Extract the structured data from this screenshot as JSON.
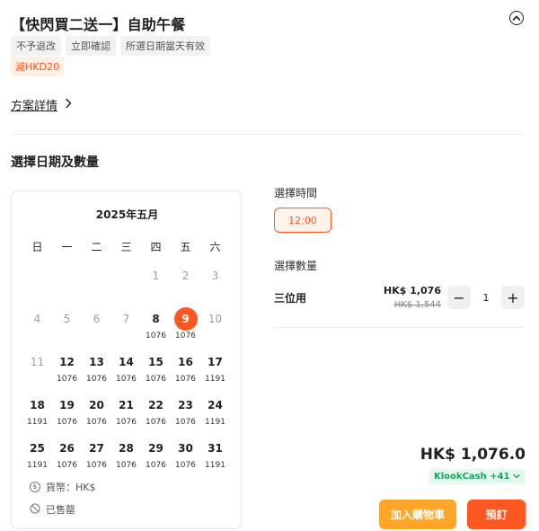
{
  "title": "【快閃買二送一】自助午餐",
  "tags": [
    "不予退改",
    "立即確認",
    "所選日期當天有效"
  ],
  "discount_badge": "減HKD20",
  "plan_details_link": "方案詳情",
  "section_title": "選擇日期及數量",
  "calendar": {
    "month_label": "2025年五月",
    "weekdays": [
      "日",
      "一",
      "二",
      "三",
      "四",
      "五",
      "六"
    ],
    "weeks": [
      [
        null,
        null,
        null,
        null,
        {
          "day": "1",
          "price": "",
          "available": false
        },
        {
          "day": "2",
          "price": "",
          "available": false
        },
        {
          "day": "3",
          "price": "",
          "available": false
        }
      ],
      [
        {
          "day": "4",
          "price": "",
          "available": false
        },
        {
          "day": "5",
          "price": "",
          "available": false
        },
        {
          "day": "6",
          "price": "",
          "available": false
        },
        {
          "day": "7",
          "price": "",
          "available": false
        },
        {
          "day": "8",
          "price": "1076",
          "available": true
        },
        {
          "day": "9",
          "price": "1076",
          "available": true,
          "selected": true
        },
        {
          "day": "10",
          "price": "",
          "available": false
        }
      ],
      [
        {
          "day": "11",
          "price": "",
          "available": false
        },
        {
          "day": "12",
          "price": "1076",
          "available": true
        },
        {
          "day": "13",
          "price": "1076",
          "available": true
        },
        {
          "day": "14",
          "price": "1076",
          "available": true
        },
        {
          "day": "15",
          "price": "1076",
          "available": true
        },
        {
          "day": "16",
          "price": "1076",
          "available": true
        },
        {
          "day": "17",
          "price": "1191",
          "available": true
        }
      ],
      [
        {
          "day": "18",
          "price": "1191",
          "available": true
        },
        {
          "day": "19",
          "price": "1076",
          "available": true
        },
        {
          "day": "20",
          "price": "1076",
          "available": true
        },
        {
          "day": "21",
          "price": "1076",
          "available": true
        },
        {
          "day": "22",
          "price": "1076",
          "available": true
        },
        {
          "day": "23",
          "price": "1076",
          "available": true
        },
        {
          "day": "24",
          "price": "1191",
          "available": true
        }
      ],
      [
        {
          "day": "25",
          "price": "1191",
          "available": true
        },
        {
          "day": "26",
          "price": "1076",
          "available": true
        },
        {
          "day": "27",
          "price": "1076",
          "available": true
        },
        {
          "day": "28",
          "price": "1076",
          "available": true
        },
        {
          "day": "29",
          "price": "1076",
          "available": true
        },
        {
          "day": "30",
          "price": "1076",
          "available": true
        },
        {
          "day": "31",
          "price": "1191",
          "available": true
        }
      ]
    ],
    "currency_note": "貨幣：HK$",
    "sold_out_note": "已售罄"
  },
  "time": {
    "label": "選擇時間",
    "selected": "12:00"
  },
  "quantity": {
    "label": "選擇數量",
    "item_name": "三位用",
    "price": "HK$ 1,076",
    "original_price": "HK$ 1,544",
    "value": "1",
    "minus": "−",
    "plus": "+"
  },
  "total": "HK$ 1,076.0",
  "klook_cash": "KlookCash +41",
  "buttons": {
    "add_to_cart": "加入購物車",
    "book": "預訂"
  },
  "colors": {
    "accent": "#ff5722",
    "cart": "#ffa628",
    "klook_green": "#10a85b"
  }
}
